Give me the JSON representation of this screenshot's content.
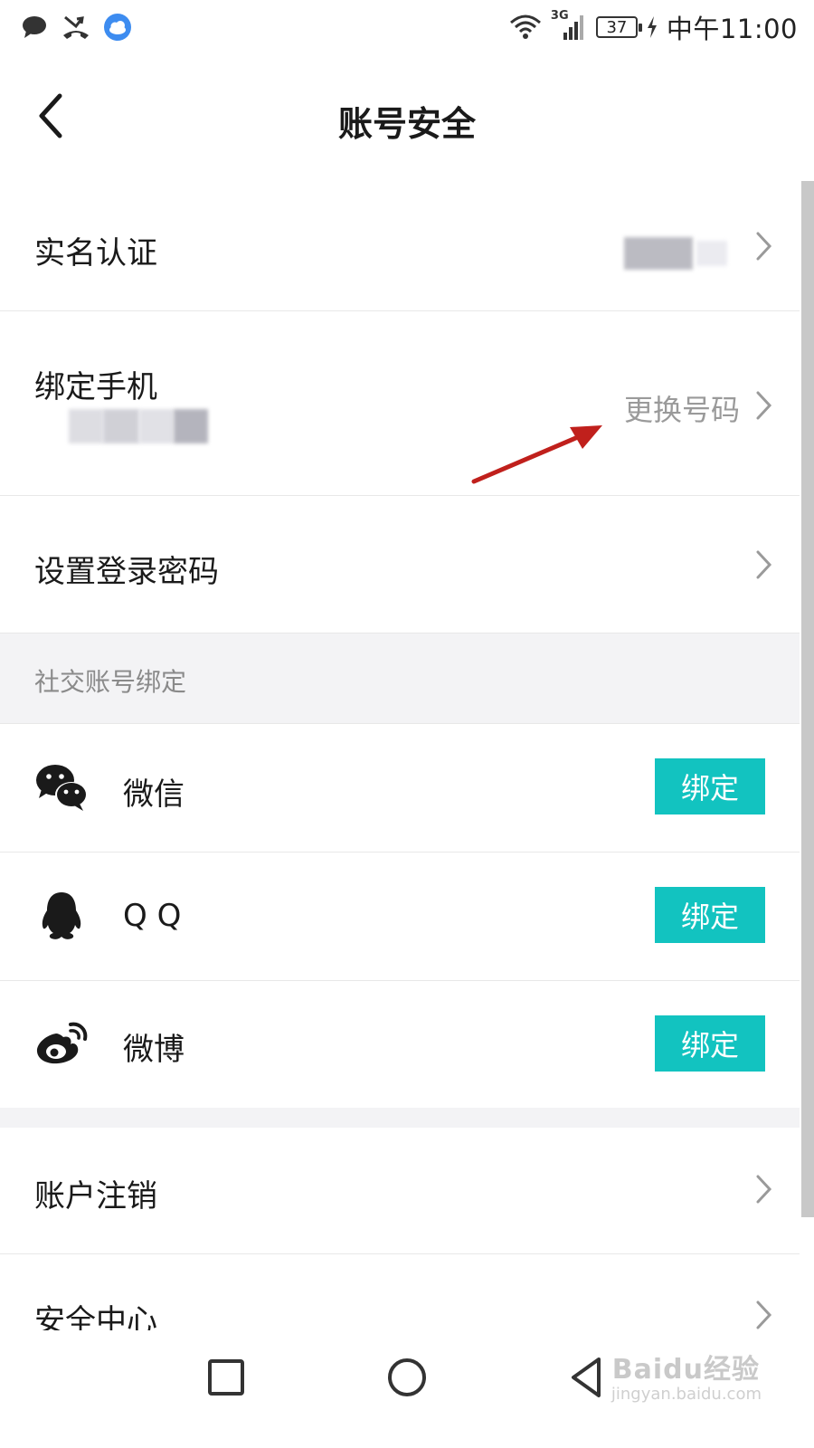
{
  "status_bar": {
    "battery": "37",
    "network": "3G",
    "time": "中午11:00"
  },
  "header": {
    "title": "账号安全"
  },
  "rows": {
    "real_name": {
      "label": "实名认证"
    },
    "phone": {
      "label": "绑定手机",
      "action": "更换号码"
    },
    "password": {
      "label": "设置登录密码"
    }
  },
  "social": {
    "section_title": "社交账号绑定",
    "items": [
      {
        "name": "微信",
        "button": "绑定",
        "icon": "wechat-icon"
      },
      {
        "name": "Q Q",
        "button": "绑定",
        "icon": "qq-icon"
      },
      {
        "name": "微博",
        "button": "绑定",
        "icon": "weibo-icon"
      }
    ]
  },
  "bottom_rows": {
    "cancel_account": {
      "label": "账户注销"
    },
    "security_center": {
      "label": "安全中心"
    }
  },
  "colors": {
    "accent": "#12c3c0",
    "annotation": "#c0201c",
    "section_bg": "#f3f3f5"
  },
  "watermark": {
    "brand": "Baidu经验",
    "url": "jingyan.baidu.com"
  }
}
